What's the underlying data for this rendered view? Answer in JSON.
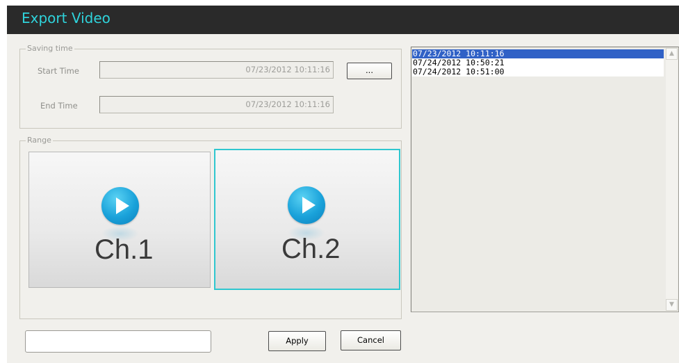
{
  "window": {
    "title": "Export Video"
  },
  "saving_time": {
    "legend": "Saving time",
    "start_label": "Start Time",
    "start_value": "07/23/2012 10:11:16",
    "end_label": "End Time",
    "end_value": "07/23/2012 10:11:16",
    "browse_label": "..."
  },
  "range": {
    "legend": "Range",
    "channels": [
      {
        "label": "Ch.1",
        "selected": false
      },
      {
        "label": "Ch.2",
        "selected": true
      }
    ]
  },
  "time_list": {
    "items": [
      {
        "text": "07/23/2012 10:11:16",
        "selected": true
      },
      {
        "text": "07/24/2012 10:50:21",
        "selected": false
      },
      {
        "text": "07/24/2012 10:51:00",
        "selected": false
      }
    ]
  },
  "footer": {
    "status_value": "",
    "apply_label": "Apply",
    "cancel_label": "Cancel"
  },
  "colors": {
    "title_accent": "#2fd3db",
    "selection": "#3061c6",
    "selected_border": "#2fc7cf",
    "play_blue": "#1aa2da"
  },
  "icons": [
    "play-icon",
    "scroll-up-arrow-icon",
    "scroll-down-arrow-icon"
  ]
}
